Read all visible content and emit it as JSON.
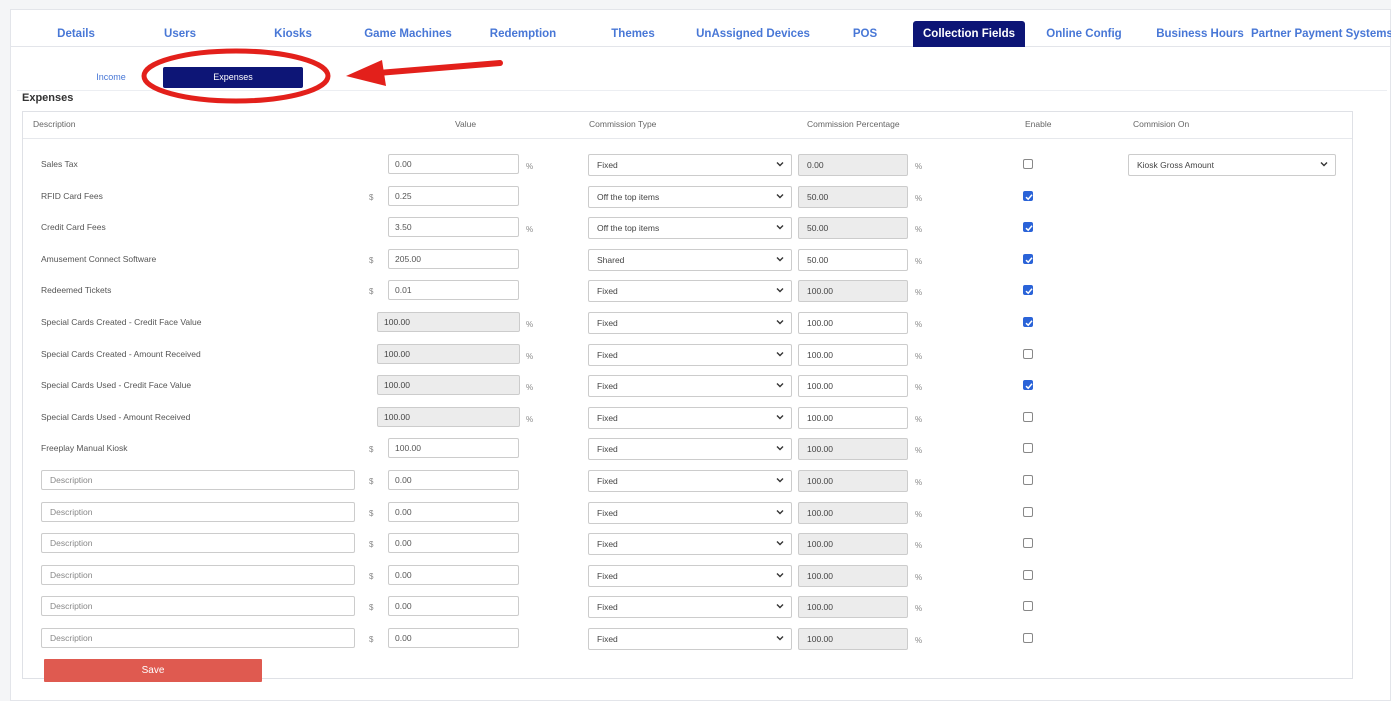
{
  "tabs": [
    {
      "label": "Details",
      "active": false
    },
    {
      "label": "Users",
      "active": false
    },
    {
      "label": "Kiosks",
      "active": false
    },
    {
      "label": "Game Machines",
      "active": false
    },
    {
      "label": "Redemption",
      "active": false
    },
    {
      "label": "Themes",
      "active": false
    },
    {
      "label": "UnAssigned Devices",
      "active": false
    },
    {
      "label": "POS",
      "active": false
    },
    {
      "label": "Collection Fields",
      "active": true
    },
    {
      "label": "Online Config",
      "active": false
    },
    {
      "label": "Business Hours",
      "active": false
    },
    {
      "label": "Partner Payment Systems",
      "active": false
    }
  ],
  "subtabs": [
    {
      "label": "Income",
      "active": false
    },
    {
      "label": "Expenses",
      "active": true
    }
  ],
  "section_title": "Expenses",
  "columns": {
    "description": "Description",
    "value": "Value",
    "commission_type": "Commission Type",
    "commission_percentage": "Commission Percentage",
    "enable": "Enable",
    "commission_on": "Commision On"
  },
  "symbols": {
    "dollar": "$",
    "percent": "%"
  },
  "commission_on_value": "Kiosk Gross Amount",
  "rows": [
    {
      "description": "Sales Tax",
      "value": "0.00",
      "unit": "%",
      "value_readonly": false,
      "commission_type": "Fixed",
      "commission_percentage": "0.00",
      "cp_editable": false,
      "enabled": false,
      "commission_on": true
    },
    {
      "description": "RFID Card Fees",
      "value": "0.25",
      "unit": "$",
      "value_readonly": false,
      "commission_type": "Off the top items",
      "commission_percentage": "50.00",
      "cp_editable": false,
      "enabled": true
    },
    {
      "description": "Credit Card Fees",
      "value": "3.50",
      "unit": "%",
      "value_readonly": false,
      "commission_type": "Off the top items",
      "commission_percentage": "50.00",
      "cp_editable": false,
      "enabled": true
    },
    {
      "description": "Amusement Connect Software",
      "value": "205.00",
      "unit": "$",
      "value_readonly": false,
      "commission_type": "Shared",
      "commission_percentage": "50.00",
      "cp_editable": true,
      "enabled": true
    },
    {
      "description": "Redeemed Tickets",
      "value": "0.01",
      "unit": "$",
      "value_readonly": false,
      "commission_type": "Fixed",
      "commission_percentage": "100.00",
      "cp_editable": false,
      "enabled": true
    },
    {
      "description": "Special Cards Created - Credit Face Value",
      "value": "100.00",
      "unit": "%",
      "value_readonly": true,
      "commission_type": "Fixed",
      "commission_percentage": "100.00",
      "cp_editable": true,
      "enabled": true
    },
    {
      "description": "Special Cards Created - Amount Received",
      "value": "100.00",
      "unit": "%",
      "value_readonly": true,
      "commission_type": "Fixed",
      "commission_percentage": "100.00",
      "cp_editable": true,
      "enabled": false
    },
    {
      "description": "Special Cards Used - Credit Face Value",
      "value": "100.00",
      "unit": "%",
      "value_readonly": true,
      "commission_type": "Fixed",
      "commission_percentage": "100.00",
      "cp_editable": true,
      "enabled": true
    },
    {
      "description": "Special Cards Used - Amount Received",
      "value": "100.00",
      "unit": "%",
      "value_readonly": true,
      "commission_type": "Fixed",
      "commission_percentage": "100.00",
      "cp_editable": true,
      "enabled": false
    },
    {
      "description": "Freeplay Manual Kiosk",
      "value": "100.00",
      "unit": "$",
      "value_readonly": false,
      "commission_type": "Fixed",
      "commission_percentage": "100.00",
      "cp_editable": false,
      "enabled": false
    },
    {
      "description": "",
      "placeholder": "Description",
      "value": "0.00",
      "unit": "$",
      "value_readonly": false,
      "commission_type": "Fixed",
      "commission_percentage": "100.00",
      "cp_editable": false,
      "enabled": false
    },
    {
      "description": "",
      "placeholder": "Description",
      "value": "0.00",
      "unit": "$",
      "value_readonly": false,
      "commission_type": "Fixed",
      "commission_percentage": "100.00",
      "cp_editable": false,
      "enabled": false
    },
    {
      "description": "",
      "placeholder": "Description",
      "value": "0.00",
      "unit": "$",
      "value_readonly": false,
      "commission_type": "Fixed",
      "commission_percentage": "100.00",
      "cp_editable": false,
      "enabled": false
    },
    {
      "description": "",
      "placeholder": "Description",
      "value": "0.00",
      "unit": "$",
      "value_readonly": false,
      "commission_type": "Fixed",
      "commission_percentage": "100.00",
      "cp_editable": false,
      "enabled": false
    },
    {
      "description": "",
      "placeholder": "Description",
      "value": "0.00",
      "unit": "$",
      "value_readonly": false,
      "commission_type": "Fixed",
      "commission_percentage": "100.00",
      "cp_editable": false,
      "enabled": false
    },
    {
      "description": "",
      "placeholder": "Description",
      "value": "0.00",
      "unit": "$",
      "value_readonly": false,
      "commission_type": "Fixed",
      "commission_percentage": "100.00",
      "cp_editable": false,
      "enabled": false
    }
  ],
  "save_label": "Save",
  "colors": {
    "tab_active_bg": "#0d1576",
    "tab_text": "#4877d6",
    "save_bg": "#df5a50",
    "checkbox_on": "#2a63d8",
    "annotation_red": "#e3201b"
  }
}
